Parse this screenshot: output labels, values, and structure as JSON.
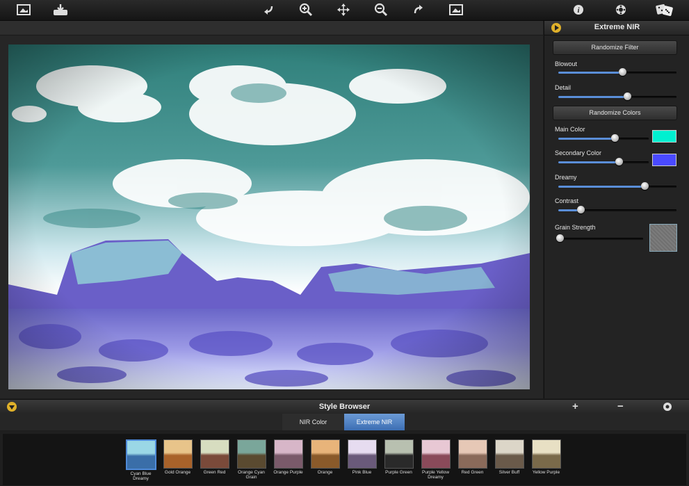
{
  "toolbar": {
    "icons": [
      "open-image-icon",
      "export-icon",
      "undo-icon",
      "zoom-in-icon",
      "pan-icon",
      "zoom-out-icon",
      "redo-icon",
      "fit-image-icon",
      "info-icon",
      "settings-icon",
      "random-dice-icon"
    ]
  },
  "panel": {
    "title": "Extreme NIR",
    "randomize_filter": "Randomize Filter",
    "randomize_colors": "Randomize Colors",
    "params": {
      "blowout": {
        "label": "Blowout",
        "value": 0.54
      },
      "detail": {
        "label": "Detail",
        "value": 0.58
      },
      "main_color": {
        "label": "Main Color",
        "value": 0.62,
        "color": "#00f0d0"
      },
      "secondary_color": {
        "label": "Secondary Color",
        "value": 0.67,
        "color": "#4a4aff"
      },
      "dreamy": {
        "label": "Dreamy",
        "value": 0.73
      },
      "contrast": {
        "label": "Contrast",
        "value": 0.19
      },
      "grain_strength": {
        "label": "Grain Strength",
        "value": 0.02
      }
    }
  },
  "browser": {
    "title": "Style Browser",
    "tabs": [
      {
        "label": "NIR Color",
        "active": false
      },
      {
        "label": "Extreme NIR",
        "active": true
      }
    ],
    "styles": [
      {
        "label": "Cyan Blue Dreamy",
        "selected": true,
        "colors": [
          "#9ad7e6",
          "#3a6ea8"
        ]
      },
      {
        "label": "Gold Orange",
        "colors": [
          "#e8c48a",
          "#a8622a"
        ]
      },
      {
        "label": "Green Red",
        "colors": [
          "#d7ddc0",
          "#7a4a3a"
        ]
      },
      {
        "label": "Orange Cyan Grain",
        "colors": [
          "#7aa69a",
          "#5a4a30"
        ]
      },
      {
        "label": "Orange Purple",
        "colors": [
          "#d7b6c8",
          "#7a5a6a"
        ]
      },
      {
        "label": "Orange",
        "colors": [
          "#e8b47a",
          "#8a5a2a"
        ]
      },
      {
        "label": "Pink Blue",
        "colors": [
          "#e6dcf0",
          "#6a5a7a"
        ]
      },
      {
        "label": "Purple Green",
        "colors": [
          "#b8c0b0",
          "#2a2a2a"
        ]
      },
      {
        "label": "Purple Yellow Dreamy",
        "colors": [
          "#e8c8d4",
          "#8a4a5a"
        ]
      },
      {
        "label": "Red Green",
        "colors": [
          "#e6c8b6",
          "#8a6a5a"
        ]
      },
      {
        "label": "Silver Buff",
        "colors": [
          "#dcd6c8",
          "#6a5a4a"
        ]
      },
      {
        "label": "Yellow Purple",
        "colors": [
          "#e8e0c4",
          "#7a6a4a"
        ]
      }
    ]
  }
}
